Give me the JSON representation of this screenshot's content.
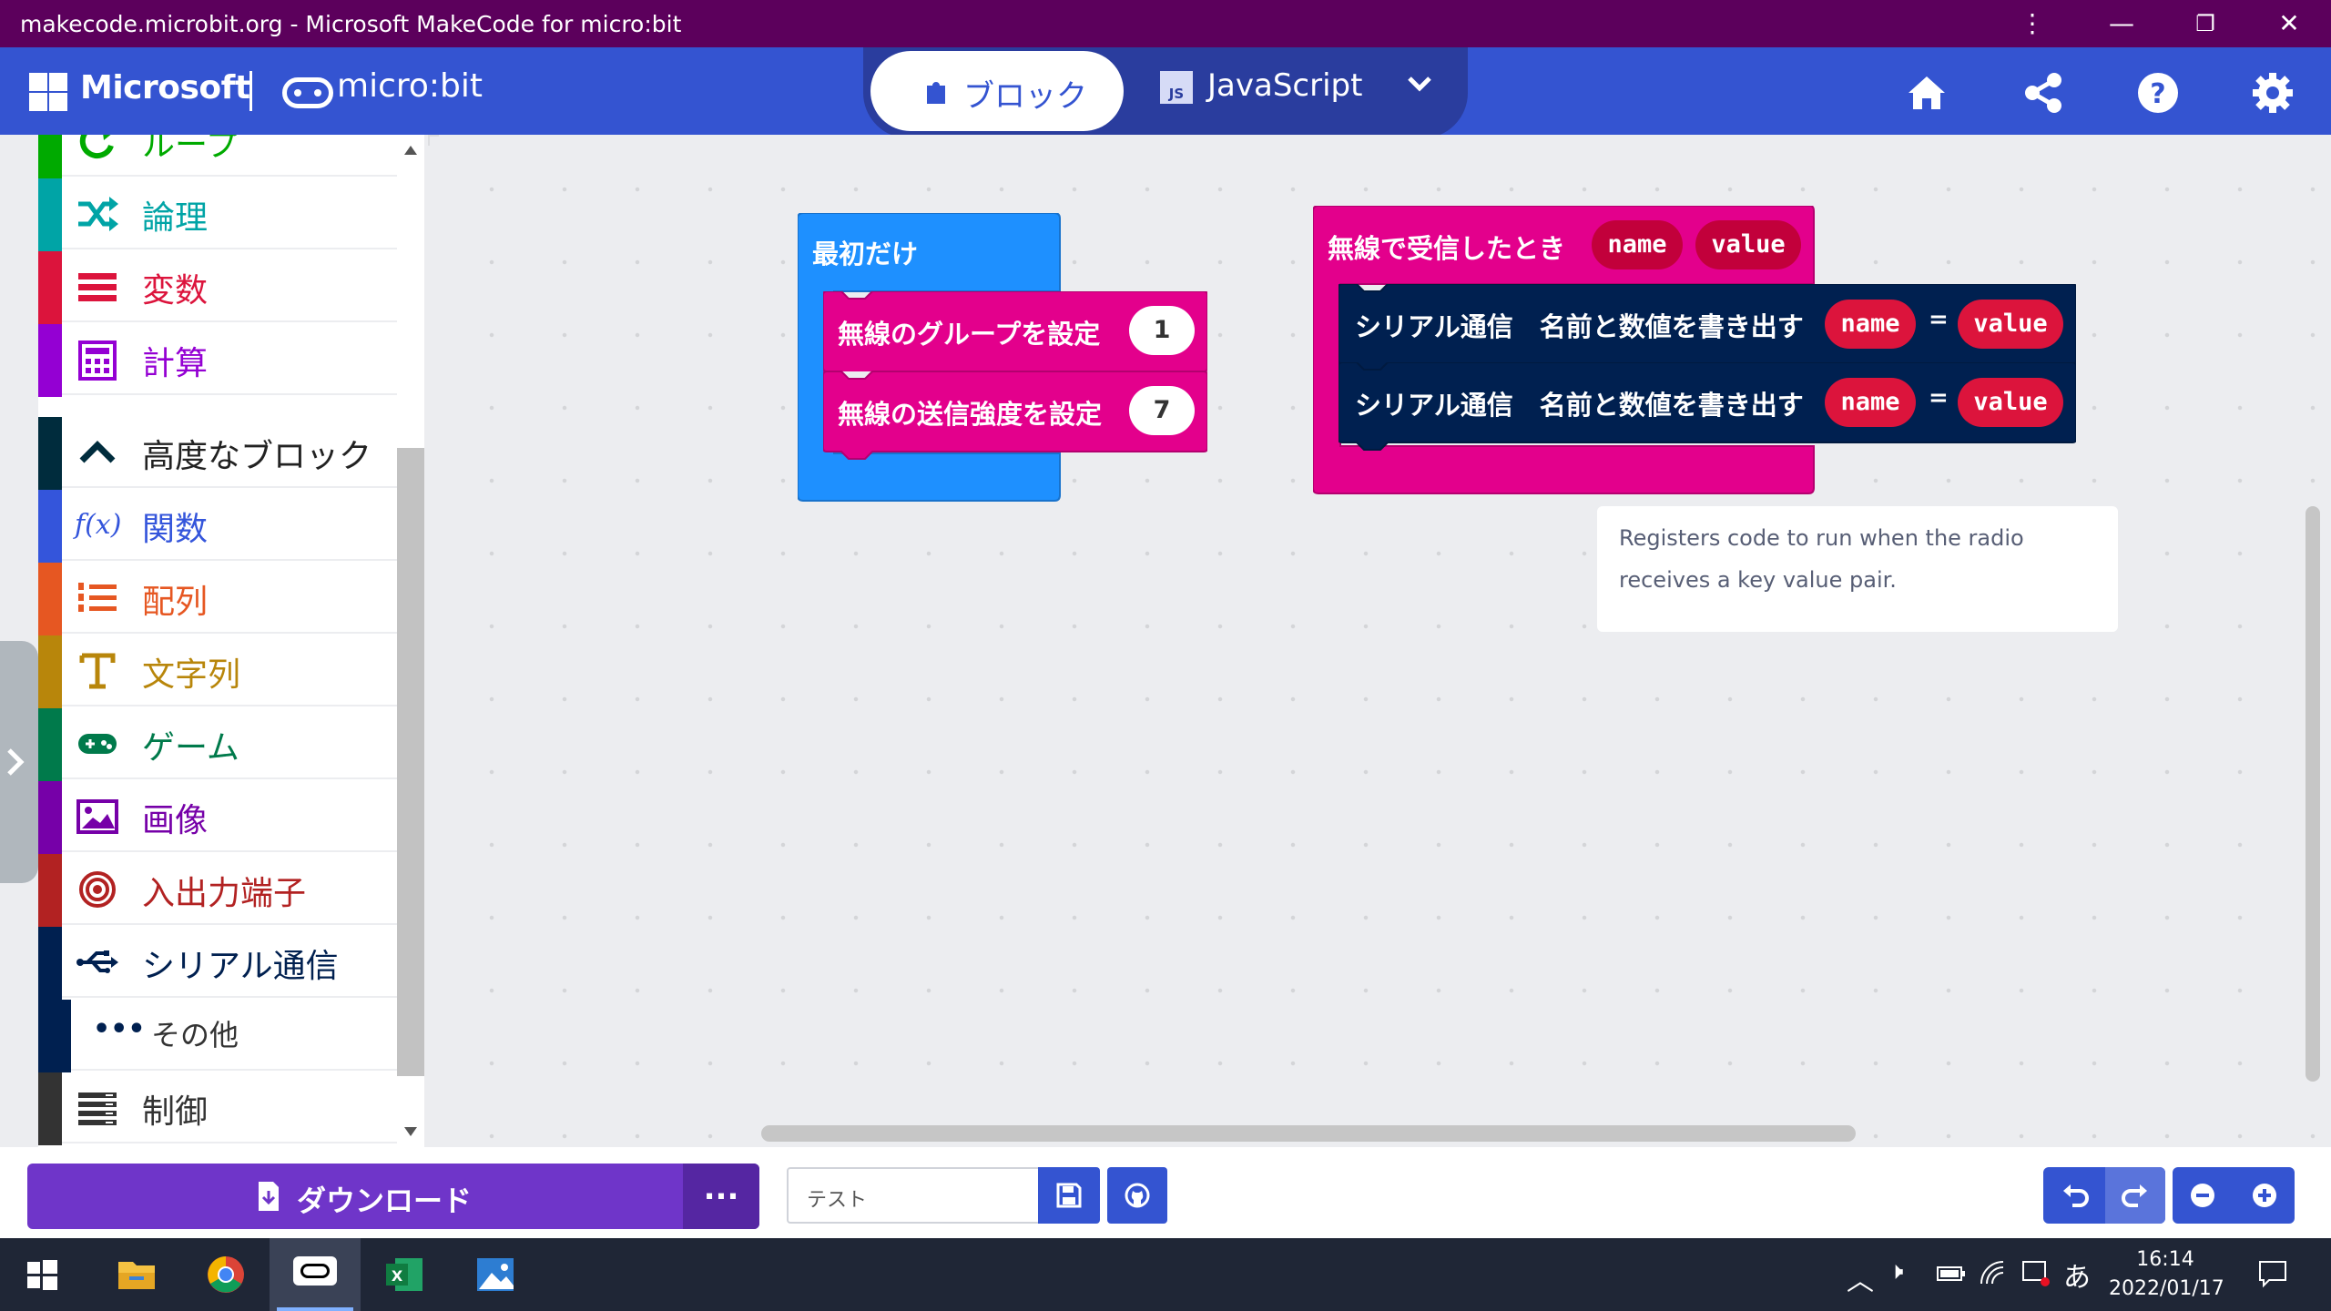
{
  "window": {
    "title": "makecode.microbit.org - Microsoft MakeCode for micro:bit",
    "controls": [
      "more-icon",
      "minimize-icon",
      "restore-icon",
      "close-icon"
    ]
  },
  "header": {
    "brand": "Microsoft",
    "product": "micro:bit",
    "tabs": {
      "blocks": "ブロック",
      "javascript": "JavaScript",
      "javascript_badge": "JS"
    },
    "icons": [
      "home-icon",
      "share-icon",
      "help-icon",
      "settings-icon"
    ]
  },
  "toolbox": {
    "categories": [
      {
        "label": "ループ",
        "color": "#00aa00",
        "icon": "loop-icon"
      },
      {
        "label": "論理",
        "color": "#00a4a6",
        "icon": "logic-icon"
      },
      {
        "label": "変数",
        "color": "#dc143c",
        "icon": "variables-icon"
      },
      {
        "label": "計算",
        "color": "#9400d3",
        "icon": "math-icon"
      },
      {
        "label": "高度なブロック",
        "color": "#002c3d",
        "icon": "chevron-up-icon"
      },
      {
        "label": "関数",
        "color": "#3455db",
        "icon": "functions-icon"
      },
      {
        "label": "配列",
        "color": "#e65722",
        "icon": "arrays-icon"
      },
      {
        "label": "文字列",
        "color": "#b8860b",
        "icon": "text-icon"
      },
      {
        "label": "ゲーム",
        "color": "#007a4b",
        "icon": "game-icon"
      },
      {
        "label": "画像",
        "color": "#7600a8",
        "icon": "images-icon"
      },
      {
        "label": "入出力端子",
        "color": "#b22222",
        "icon": "pins-icon"
      },
      {
        "label": "シリアル通信",
        "color": "#002050",
        "icon": "serial-icon"
      },
      {
        "label": "その他",
        "color": "#002050",
        "icon": "more-icon"
      },
      {
        "label": "制御",
        "color": "#333333",
        "icon": "control-icon"
      }
    ]
  },
  "workspace": {
    "on_start": {
      "label": "最初だけ",
      "color": "#1e90ff",
      "statements": [
        {
          "label": "無線のグループを設定",
          "value": "1"
        },
        {
          "label": "無線の送信強度を設定",
          "value": "7"
        }
      ]
    },
    "on_received": {
      "label": "無線で受信したとき",
      "color": "#e3008c",
      "params": [
        "name",
        "value"
      ],
      "statements": [
        {
          "label": "シリアル通信　名前と数値を書き出す",
          "name": "name",
          "eq": "=",
          "value": "value"
        },
        {
          "label": "シリアル通信　名前と数値を書き出す",
          "name": "name",
          "eq": "=",
          "value": "value"
        }
      ]
    },
    "tooltip": "Registers code to run when the radio receives a key value pair."
  },
  "bottombar": {
    "download": "ダウンロード",
    "more": "...",
    "project_name": "テスト"
  },
  "taskbar": {
    "apps": [
      "windows-start-icon",
      "file-explorer-icon",
      "chrome-icon",
      "makecode-icon",
      "excel-icon",
      "photos-icon"
    ],
    "ime": "あ",
    "time": "16:14",
    "date": "2022/01/17"
  }
}
